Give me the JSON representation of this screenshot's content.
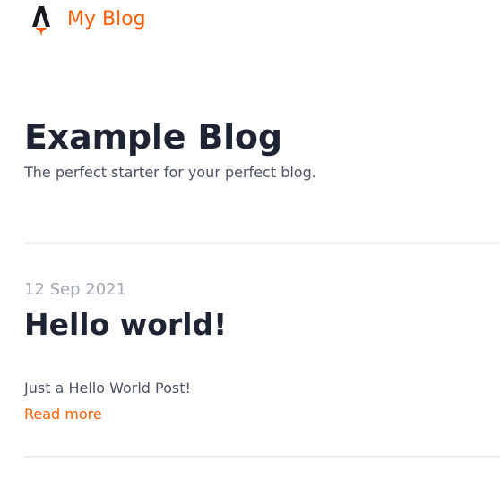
{
  "header": {
    "site_title": "My Blog",
    "logo": "astro-logo-icon",
    "accent_color": "#ff5d01"
  },
  "hero": {
    "title": "Example Blog",
    "description": "The perfect starter for your perfect blog."
  },
  "posts": [
    {
      "date": "12 Sep 2021",
      "title": "Hello world!",
      "excerpt": "Just a Hello World Post!",
      "read_more": "Read more"
    }
  ]
}
